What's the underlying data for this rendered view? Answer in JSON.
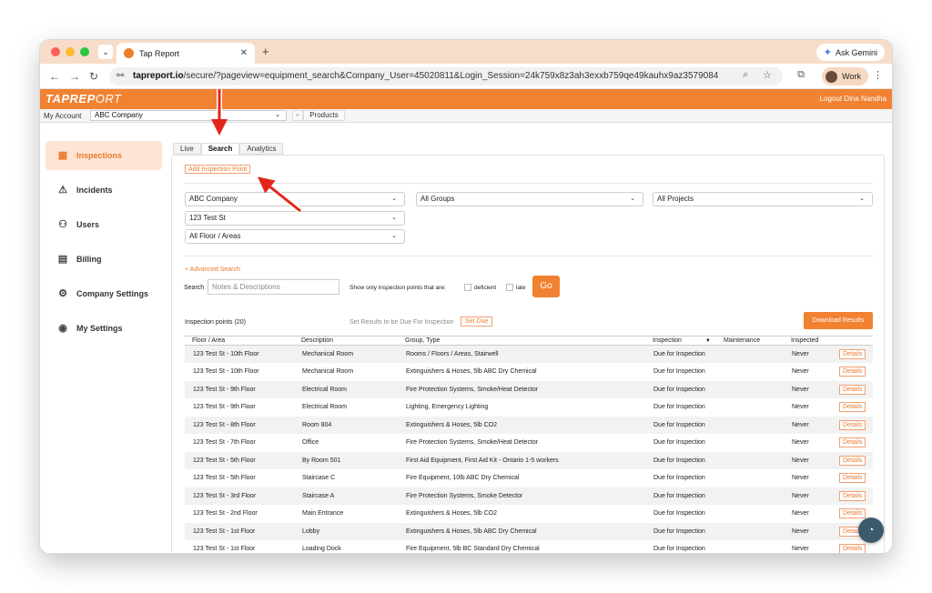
{
  "browser": {
    "tab_title": "Tap Report",
    "new_tab": "+",
    "gemini_label": "Ask Gemini",
    "url_host": "tapreport.io",
    "url_path": "/secure/?pageview=equipment_search&Company_User=45020811&Login_Session=24k759x8z3ah3exxb759qe49kauhx9az3579084",
    "profile_label": "Work"
  },
  "app": {
    "logo_bold": "TAPREP",
    "logo_light": "RT",
    "logo_mark": "O",
    "logout": "Logout Dina Nandha"
  },
  "account_bar": {
    "label": "My Account",
    "company": "ABC Company",
    "products": "Products",
    "plus": "+"
  },
  "sidebar": {
    "items": [
      {
        "label": "Inspections",
        "icon": "clipboard-icon",
        "glyph": "▦"
      },
      {
        "label": "Incidents",
        "icon": "warning-icon",
        "glyph": "⚠"
      },
      {
        "label": "Users",
        "icon": "users-icon",
        "glyph": "⚇"
      },
      {
        "label": "Billing",
        "icon": "invoice-icon",
        "glyph": "▤"
      },
      {
        "label": "Company Settings",
        "icon": "gear-icon",
        "glyph": "⚙"
      },
      {
        "label": "My Settings",
        "icon": "user-circle-icon",
        "glyph": "◉"
      }
    ]
  },
  "page_tabs": [
    "Live",
    "Search",
    "Analytics"
  ],
  "add_inspection_point": "Add Inspection Point",
  "filters": {
    "company": "ABC Company",
    "groups": "All Groups",
    "projects": "All Projects",
    "site": "123 Test St",
    "floors": "All Floor / Areas"
  },
  "advanced_search": "+ Advanced Search",
  "search": {
    "label": "Search",
    "placeholder": "Notes & Descriptions",
    "show_only": "Show only inspection points that are:",
    "deficient": "deficient",
    "late": "late",
    "go": "Go"
  },
  "results": {
    "count_label": "Inspection points (20)",
    "set_results": "Set Results to be Due For Inspection",
    "set_due": "Set Due",
    "download": "Download Results"
  },
  "table": {
    "headers": [
      "Floor / Area",
      "Description",
      "Group, Type",
      "Inspection",
      "Maintenance",
      "Inspected",
      ""
    ],
    "sort_arrow": "▼",
    "details_label": "Details",
    "rows": [
      [
        "123 Test St - 10th Floor",
        "Mechanical Room",
        "Rooms / Floors / Areas, Stairwell",
        "Due for Inspection",
        "",
        "Never"
      ],
      [
        "123 Test St - 10th Floor",
        "Mechanical Room",
        "Extinguishers & Hoses, 5lb ABC Dry Chemical",
        "Due for Inspection",
        "",
        "Never"
      ],
      [
        "123 Test St - 9th Floor",
        "Electrical Room",
        "Fire Protection Systems, Smoke/Heat Detector",
        "Due for Inspection",
        "",
        "Never"
      ],
      [
        "123 Test St - 9th Floor",
        "Electrical Room",
        "Lighting, Emergency Lighting",
        "Due for Inspection",
        "",
        "Never"
      ],
      [
        "123 Test St - 8th Floor",
        "Room 804",
        "Extinguishers & Hoses, 5lb CO2",
        "Due for Inspection",
        "",
        "Never"
      ],
      [
        "123 Test St - 7th Floor",
        "Office",
        "Fire Protection Systems, Smoke/Heat Detector",
        "Due for Inspection",
        "",
        "Never"
      ],
      [
        "123 Test St - 5th Floor",
        "By Room 501",
        "First Aid Equipment, First Aid Kit - Ontario 1-5 workers",
        "Due for Inspection",
        "",
        "Never"
      ],
      [
        "123 Test St - 5th Floor",
        "Staircase C",
        "Fire Equipment, 10lb ABC Dry Chemical",
        "Due for Inspection",
        "",
        "Never"
      ],
      [
        "123 Test St - 3rd Floor",
        "Staircase A",
        "Fire Protection Systems, Smoke Detector",
        "Due for Inspection",
        "",
        "Never"
      ],
      [
        "123 Test St - 2nd Floor",
        "Main Entrance",
        "Extinguishers & Hoses, 5lb CO2",
        "Due for Inspection",
        "",
        "Never"
      ],
      [
        "123 Test St - 1st Floor",
        "Lobby",
        "Extinguishers & Hoses, 5lb ABC Dry Chemical",
        "Due for Inspection",
        "",
        "Never"
      ],
      [
        "123 Test St - 1st Floor",
        "Loading Dock",
        "Fire Equipment, 5lb BC Standard Dry Chemical",
        "Due for Inspection",
        "",
        "Never"
      ]
    ]
  },
  "colors": {
    "brand_orange": "#f08232",
    "arrow_red": "#e3261c"
  }
}
